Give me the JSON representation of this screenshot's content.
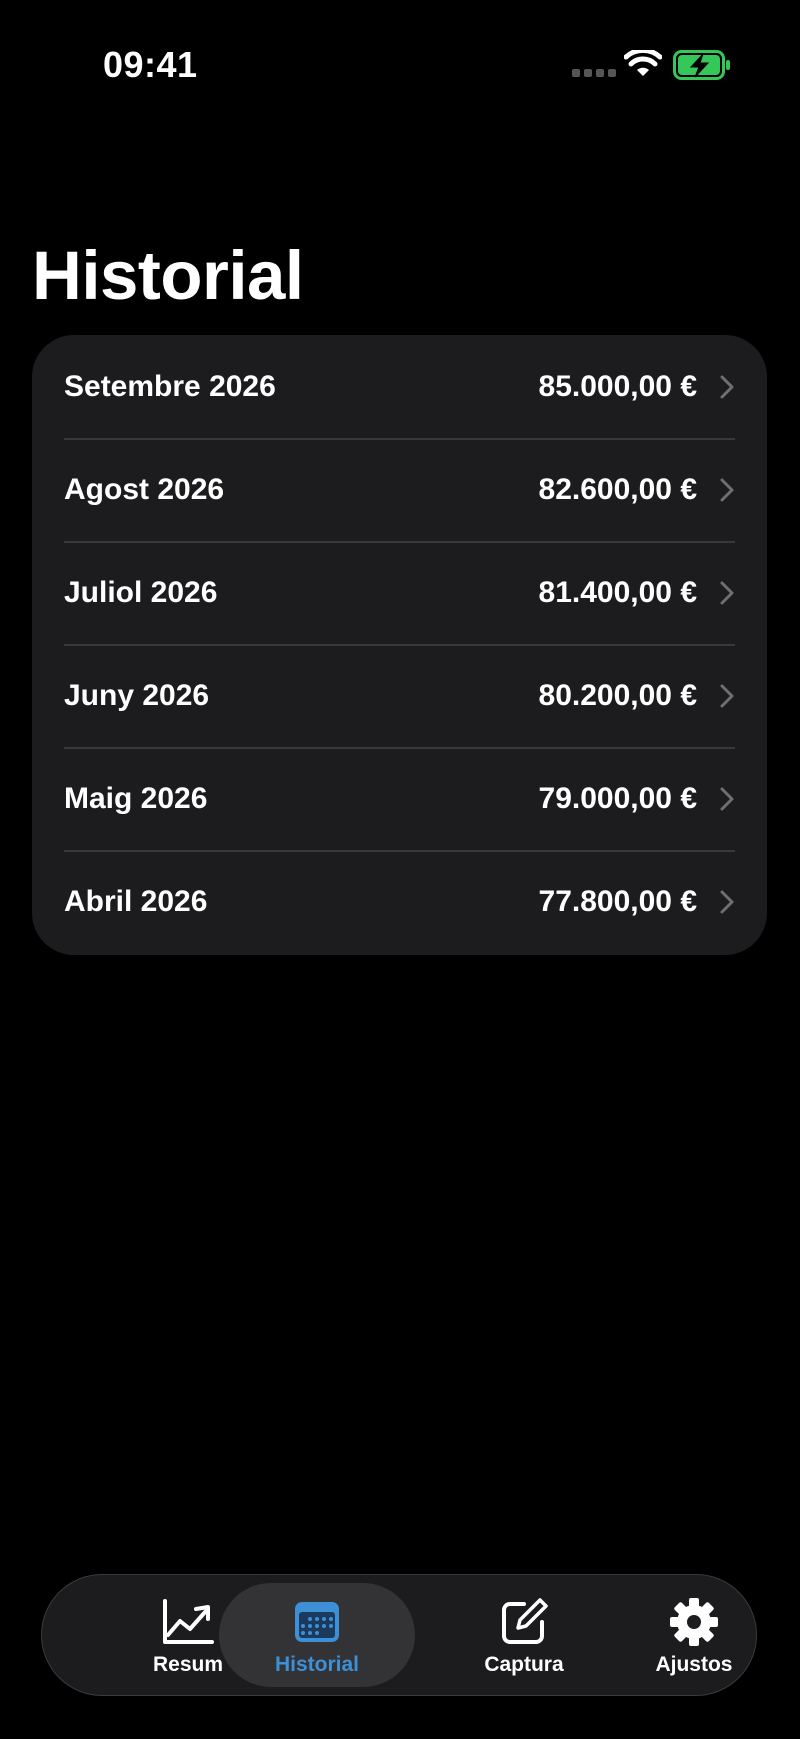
{
  "status_bar": {
    "time": "09:41"
  },
  "page": {
    "title": "Historial"
  },
  "history": [
    {
      "month": "Setembre 2026",
      "amount": "85.000,00 €"
    },
    {
      "month": "Agost 2026",
      "amount": "82.600,00 €"
    },
    {
      "month": "Juliol 2026",
      "amount": "81.400,00 €"
    },
    {
      "month": "Juny 2026",
      "amount": "80.200,00 €"
    },
    {
      "month": "Maig 2026",
      "amount": "79.000,00 €"
    },
    {
      "month": "Abril 2026",
      "amount": "77.800,00 €"
    }
  ],
  "tabbar": {
    "tabs": [
      {
        "label": "Resum",
        "icon": "chart-line-icon",
        "active": false
      },
      {
        "label": "Historial",
        "icon": "calendar-icon",
        "active": true
      },
      {
        "label": "Captura",
        "icon": "edit-icon",
        "active": false
      },
      {
        "label": "Ajustos",
        "icon": "gear-icon",
        "active": false
      }
    ]
  },
  "colors": {
    "background": "#000000",
    "card": "#1c1c1e",
    "separator": "#38383a",
    "accent": "#3d8fd6",
    "battery": "#34c759"
  }
}
